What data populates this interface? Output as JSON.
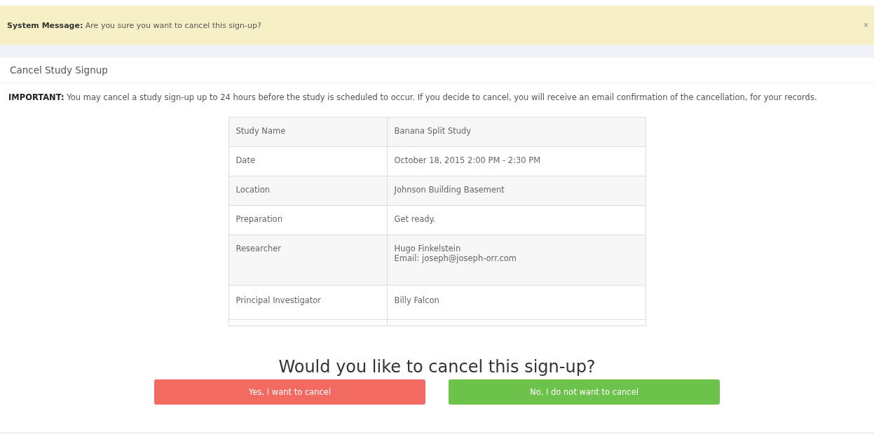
{
  "system_message": {
    "label": "System Message:",
    "text": "Are you sure you want to cancel this sign-up?",
    "close": "×"
  },
  "panel": {
    "title": "Cancel Study Signup",
    "notice": "**IMPORTANT:** You may cancel a study sign-up up to 24 hours before the study is scheduled to occur. If you decide to cancel, you will receive an email confirmation of the cancellation, for your records."
  },
  "details": [
    {
      "label": "Study Name",
      "values": [
        "Banana Split Study"
      ]
    },
    {
      "label": "Date",
      "values": [
        "October 18, 2015 2:00 PM - 2:30 PM"
      ]
    },
    {
      "label": "Location",
      "values": [
        "Johnson Building Basement"
      ]
    },
    {
      "label": "Preparation",
      "values": [
        "Get ready."
      ]
    },
    {
      "label": "Researcher",
      "values": [
        "Hugo Finkelstein",
        "Email: joseph@joseph-orr.com"
      ]
    },
    {
      "label": "Principal Investigator",
      "values": [
        "Billy Falcon"
      ]
    }
  ],
  "question": "Would you like to cancel this sign-up?",
  "buttons": [
    {
      "label": "Yes, I want to cancel",
      "kind": "danger"
    },
    {
      "label": "No, I do not want to cancel",
      "kind": "success"
    }
  ]
}
